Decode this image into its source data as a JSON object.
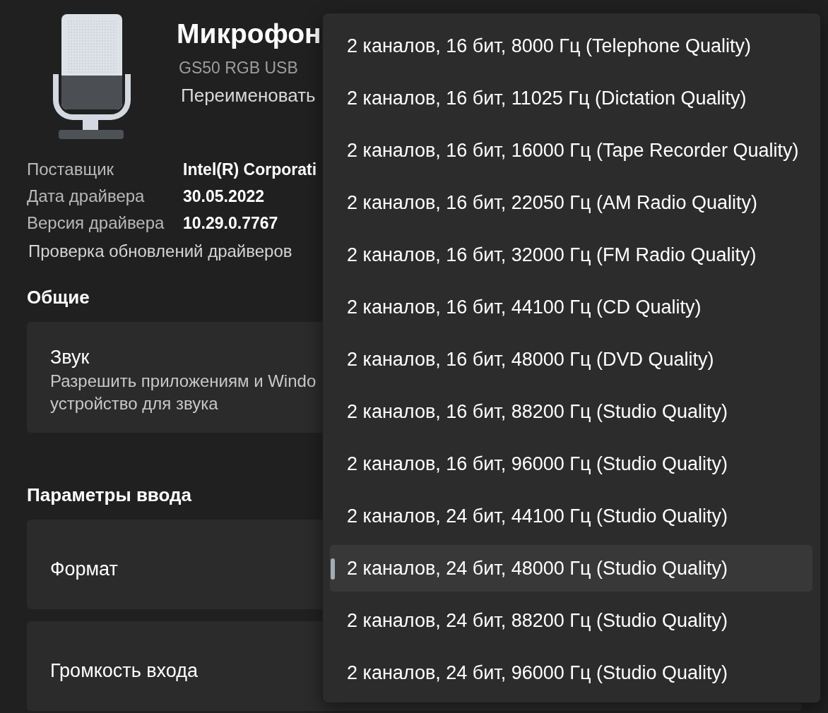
{
  "device": {
    "title": "Микрофон",
    "subtitle": "GS50 RGB USB",
    "rename_link": "Переименовать"
  },
  "driver_info": [
    {
      "label": "Поставщик",
      "value": "Intel(R) Corporati"
    },
    {
      "label": "Дата драйвера",
      "value": "30.05.2022"
    },
    {
      "label": "Версия драйвера",
      "value": "10.29.0.7767"
    }
  ],
  "update_link": "Проверка обновлений драйверов",
  "sections": [
    {
      "heading": "Общие",
      "cards": [
        {
          "title": "Звук",
          "description": "Разрешить приложениям и Windo\nустройство для звука"
        }
      ]
    },
    {
      "heading": "Параметры ввода",
      "cards": [
        {
          "title": "Формат"
        },
        {
          "title": "Громкость входа"
        }
      ]
    }
  ],
  "format_menu": {
    "options": [
      {
        "label": "2 каналов, 16 бит, 8000 Гц (Telephone Quality)",
        "selected": false
      },
      {
        "label": "2 каналов, 16 бит, 11025 Гц (Dictation Quality)",
        "selected": false
      },
      {
        "label": "2 каналов, 16 бит, 16000 Гц (Tape Recorder Quality)",
        "selected": false
      },
      {
        "label": "2 каналов, 16 бит, 22050 Гц (AM Radio Quality)",
        "selected": false
      },
      {
        "label": "2 каналов, 16 бит, 32000 Гц (FM Radio Quality)",
        "selected": false
      },
      {
        "label": "2 каналов, 16 бит, 44100 Гц (CD Quality)",
        "selected": false
      },
      {
        "label": "2 каналов, 16 бит, 48000 Гц (DVD Quality)",
        "selected": false
      },
      {
        "label": "2 каналов, 16 бит, 88200 Гц (Studio Quality)",
        "selected": false
      },
      {
        "label": "2 каналов, 16 бит, 96000 Гц (Studio Quality)",
        "selected": false
      },
      {
        "label": "2 каналов, 24 бит, 44100 Гц (Studio Quality)",
        "selected": false
      },
      {
        "label": "2 каналов, 24 бит, 48000 Гц (Studio Quality)",
        "selected": true
      },
      {
        "label": "2 каналов, 24 бит, 88200 Гц (Studio Quality)",
        "selected": false
      },
      {
        "label": "2 каналов, 24 бит, 96000 Гц (Studio Quality)",
        "selected": false
      }
    ]
  }
}
